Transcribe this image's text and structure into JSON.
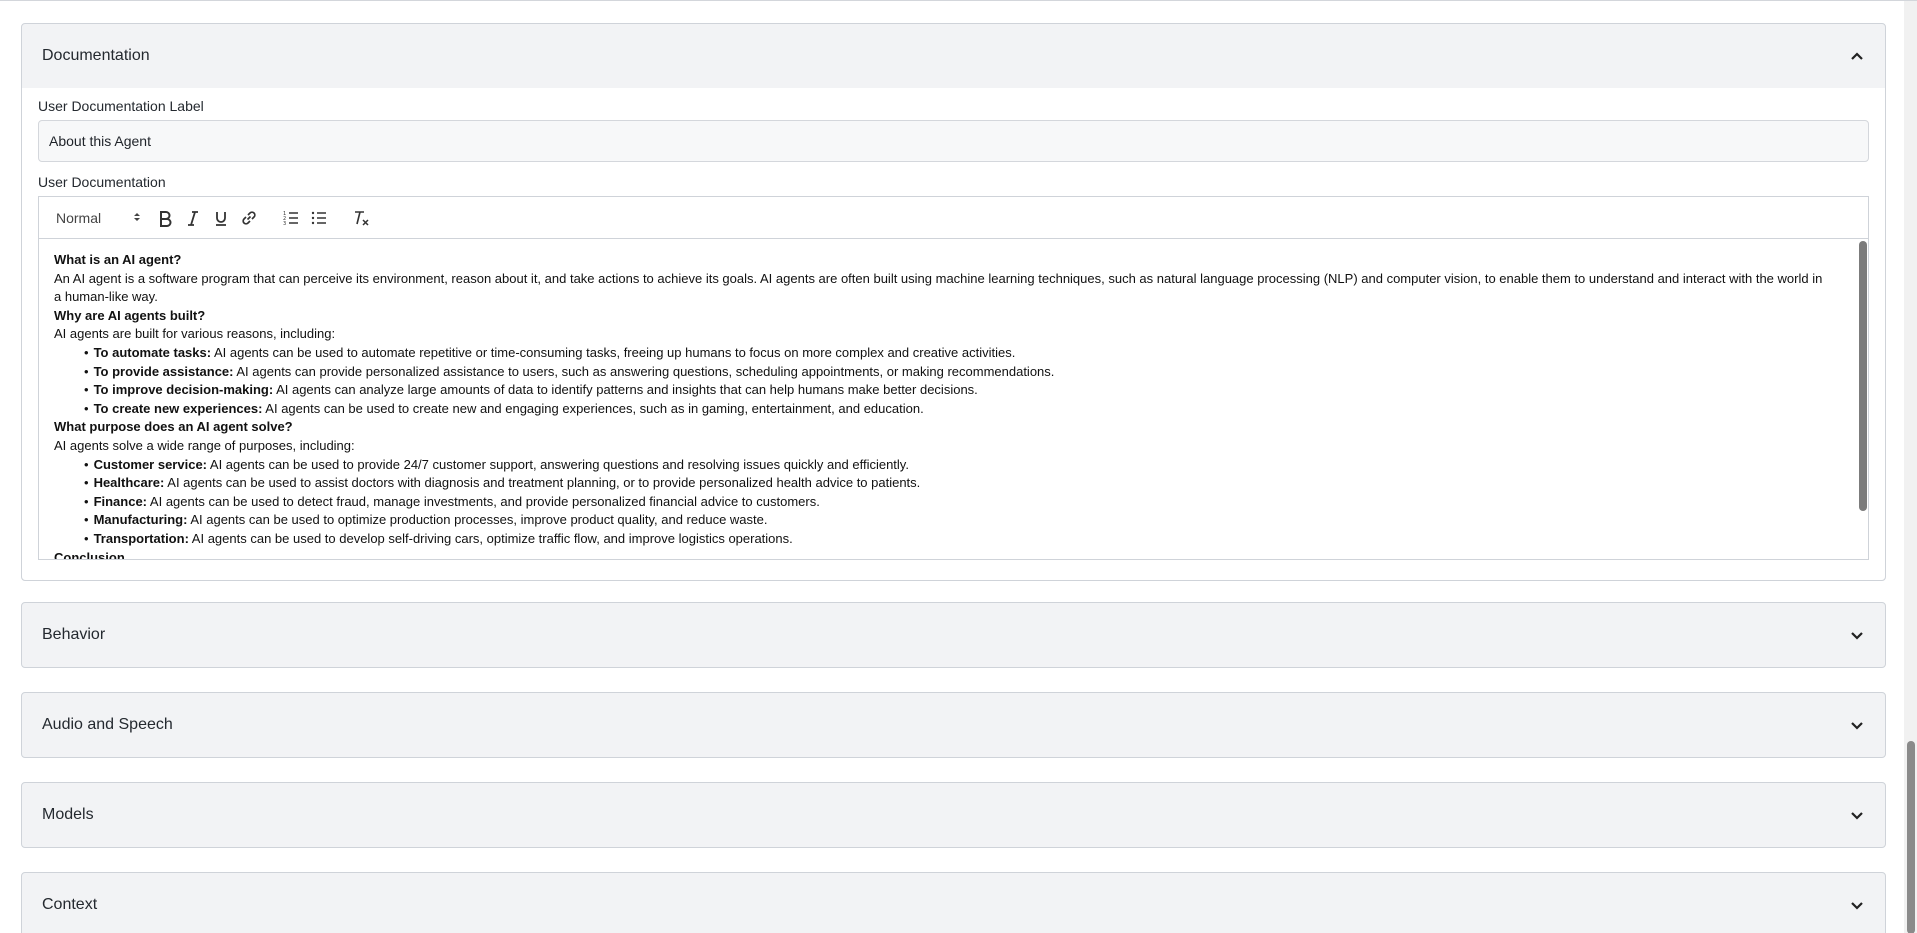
{
  "sections": {
    "documentation": {
      "title": "Documentation",
      "label_field_label": "User Documentation Label",
      "label_field_value": "About this Agent",
      "doc_field_label": "User Documentation",
      "toolbar": {
        "format": "Normal",
        "buttons": [
          "bold-icon",
          "italic-icon",
          "underline-icon",
          "link-icon",
          "ordered-list-icon",
          "bullet-list-icon",
          "clear-format-icon"
        ]
      },
      "content": {
        "h1": "What is an AI agent?",
        "p1": "An AI agent is a software program that can perceive its environment, reason about it, and take actions to achieve its goals. AI agents are often built using machine learning techniques, such as natural language processing (NLP) and computer vision, to enable them to understand and interact with the world in a human-like way.",
        "h2": "Why are AI agents built?",
        "p2": "AI agents are built for various reasons, including:",
        "list1": [
          {
            "bold": "To automate tasks:",
            "text": " AI agents can be used to automate repetitive or time-consuming tasks, freeing up humans to focus on more complex and creative activities."
          },
          {
            "bold": "To provide assistance:",
            "text": " AI agents can provide personalized assistance to users, such as answering questions, scheduling appointments, or making recommendations."
          },
          {
            "bold": "To improve decision-making:",
            "text": " AI agents can analyze large amounts of data to identify patterns and insights that can help humans make better decisions."
          },
          {
            "bold": "To create new experiences:",
            "text": " AI agents can be used to create new and engaging experiences, such as in gaming, entertainment, and education."
          }
        ],
        "h3": "What purpose does an AI agent solve?",
        "p3": "AI agents solve a wide range of purposes, including:",
        "list2": [
          {
            "bold": "Customer service:",
            "text": " AI agents can be used to provide 24/7 customer support, answering questions and resolving issues quickly and efficiently."
          },
          {
            "bold": "Healthcare:",
            "text": " AI agents can be used to assist doctors with diagnosis and treatment planning, or to provide personalized health advice to patients."
          },
          {
            "bold": "Finance:",
            "text": " AI agents can be used to detect fraud, manage investments, and provide personalized financial advice to customers."
          },
          {
            "bold": "Manufacturing:",
            "text": " AI agents can be used to optimize production processes, improve product quality, and reduce waste."
          },
          {
            "bold": "Transportation:",
            "text": " AI agents can be used to develop self-driving cars, optimize traffic flow, and improve logistics operations."
          }
        ],
        "h4": "Conclusion"
      }
    },
    "behavior": {
      "title": "Behavior"
    },
    "audio": {
      "title": "Audio and Speech"
    },
    "models": {
      "title": "Models"
    },
    "context": {
      "title": "Context"
    }
  }
}
